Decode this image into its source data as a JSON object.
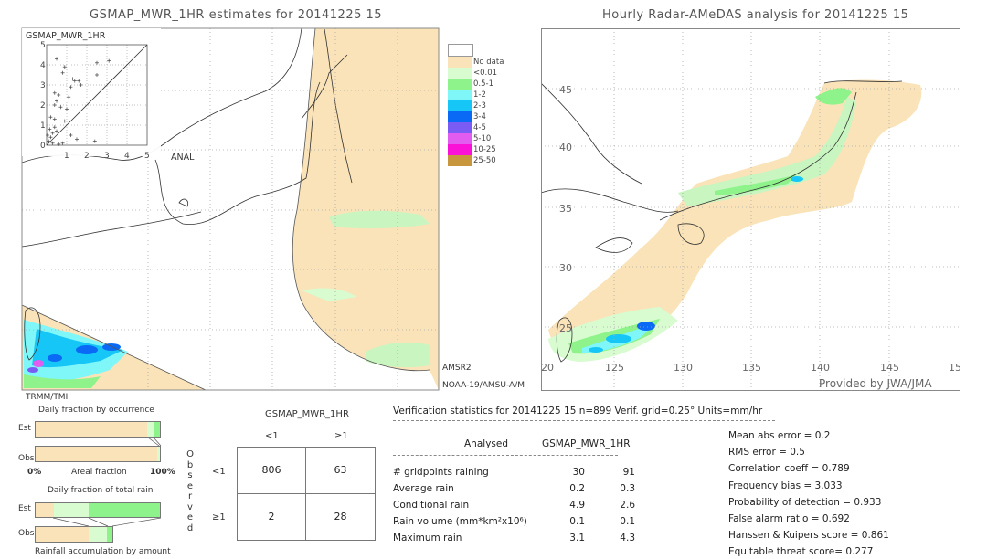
{
  "left_panel": {
    "title": "GSMAP_MWR_1HR estimates for 20141225 15",
    "inset_title": "GSMAP_MWR_1HR",
    "inset_xlabel": "ANAL",
    "sensor_labels": [
      "AMSR2",
      "NOAA-19/AMSU-A/M",
      "TRMM/TMI"
    ]
  },
  "legend": {
    "items": [
      {
        "label": "No data",
        "color": "#fae3b8"
      },
      {
        "label": "<0.01",
        "color": "#d8fbd0"
      },
      {
        "label": "0.5-1",
        "color": "#8ef38a"
      },
      {
        "label": "1-2",
        "color": "#7ff6f8"
      },
      {
        "label": "2-3",
        "color": "#16c6f7"
      },
      {
        "label": "3-4",
        "color": "#0a6af5"
      },
      {
        "label": "4-5",
        "color": "#7a5cf5"
      },
      {
        "label": "5-10",
        "color": "#e35cf0"
      },
      {
        "label": "10-25",
        "color": "#fa10d6"
      },
      {
        "label": "25-50",
        "color": "#c8963c"
      }
    ]
  },
  "right_panel": {
    "title": "Hourly Radar-AMeDAS analysis for 20141225 15",
    "credit": "Provided by JWA/JMA",
    "lat_labels": [
      "45",
      "40",
      "35",
      "30",
      "25"
    ],
    "lon_labels": [
      "20",
      "125",
      "130",
      "135",
      "140",
      "145",
      "15"
    ]
  },
  "occurrence": {
    "title": "Daily fraction by occurrence",
    "est_label": "Est",
    "obs_label": "Obs",
    "axis_left": "0%",
    "axis_mid": "Areal fraction",
    "axis_right": "100%"
  },
  "total_rain": {
    "title": "Daily fraction of total rain",
    "est_label": "Est",
    "obs_label": "Obs",
    "footer": "Rainfall accumulation by amount"
  },
  "contingency": {
    "title": "GSMAP_MWR_1HR",
    "col_labels": [
      "<1",
      "≥1"
    ],
    "row_labels": [
      "<1",
      "≥1"
    ],
    "side_label": [
      "O",
      "b",
      "s",
      "e",
      "r",
      "v",
      "e",
      "d"
    ],
    "cells": [
      [
        "806",
        "63"
      ],
      [
        "2",
        "28"
      ]
    ]
  },
  "stats": {
    "header": "Verification statistics for 20141225 15   n=899   Verif. grid=0.25°   Units=mm/hr",
    "col_analysed": "Analysed",
    "col_gsmap": "GSMAP_MWR_1HR",
    "rows": [
      {
        "label": "# gridpoints raining",
        "a": "30",
        "g": "91"
      },
      {
        "label": "Average rain",
        "a": "0.2",
        "g": "0.3"
      },
      {
        "label": "Conditional rain",
        "a": "4.9",
        "g": "2.6"
      },
      {
        "label": "Rain volume (mm*km²x10⁶)",
        "a": "0.1",
        "g": "0.1"
      },
      {
        "label": "Maximum rain",
        "a": "3.1",
        "g": "4.3"
      }
    ],
    "scores": [
      "Mean abs error = 0.2",
      "RMS error = 0.5",
      "Correlation coeff = 0.789",
      "Frequency bias = 3.033",
      "Probability of detection = 0.933",
      "False alarm ratio = 0.692",
      "Hanssen & Kuipers score = 0.861",
      "Equitable threat score= 0.277"
    ]
  },
  "chart_data": [
    {
      "type": "scatter",
      "title": "GSMAP_MWR_1HR",
      "xlabel": "ANAL",
      "ylabel": "GSMAP_MWR_1HR",
      "xlim": [
        0,
        5
      ],
      "ylim": [
        0,
        5
      ],
      "ticks": [
        "0",
        "1",
        "2",
        "3",
        "4",
        "5"
      ],
      "grid": true,
      "points": [
        [
          0.5,
          4.3
        ],
        [
          2.5,
          4.1
        ],
        [
          3.1,
          4.2
        ],
        [
          2.5,
          3.5
        ],
        [
          0.9,
          3.9
        ],
        [
          0.8,
          3.6
        ],
        [
          1.3,
          3.3
        ],
        [
          1.4,
          3.2
        ],
        [
          1.6,
          3.2
        ],
        [
          1.7,
          3.0
        ],
        [
          1.2,
          2.9
        ],
        [
          0.4,
          2.6
        ],
        [
          0.6,
          2.5
        ],
        [
          1.1,
          2.4
        ],
        [
          0.5,
          2.2
        ],
        [
          0.4,
          2.0
        ],
        [
          0.7,
          1.9
        ],
        [
          1.0,
          1.8
        ],
        [
          0.2,
          1.4
        ],
        [
          0.4,
          1.3
        ],
        [
          0.9,
          1.2
        ],
        [
          2.4,
          0.2
        ],
        [
          1.2,
          0.5
        ],
        [
          0.4,
          0.9
        ],
        [
          0.5,
          0.7
        ],
        [
          0.3,
          0.6
        ],
        [
          0.2,
          0.4
        ],
        [
          0.1,
          0.2
        ],
        [
          0.3,
          0.1
        ],
        [
          0.6,
          0.05
        ],
        [
          0.8,
          0.1
        ],
        [
          1.5,
          0.3
        ],
        [
          0.05,
          0.5
        ],
        [
          0.15,
          0.8
        ]
      ],
      "diagonal": true
    },
    {
      "type": "bar",
      "title": "Daily fraction by occurrence",
      "categories": [
        "Est",
        "Obs"
      ],
      "series": [
        {
          "color": "#fae3b8",
          "values": [
            90,
            98
          ]
        },
        {
          "color": "#d8fbd0",
          "values": [
            5,
            2
          ]
        },
        {
          "color": "#8ef38a",
          "values": [
            5,
            0
          ]
        }
      ],
      "xlim": [
        0,
        100
      ]
    },
    {
      "type": "bar",
      "title": "Daily fraction of total rain",
      "categories": [
        "Est",
        "Obs"
      ],
      "series": [
        {
          "color": "#fae3b8",
          "values": [
            15,
            43
          ]
        },
        {
          "color": "#d8fbd0",
          "values": [
            28,
            15
          ]
        },
        {
          "color": "#8ef38a",
          "values": [
            57,
            4
          ]
        }
      ],
      "xlim": [
        0,
        100
      ]
    },
    {
      "type": "table",
      "title": "GSMAP_MWR_1HR",
      "rows": [
        "<1",
        "≥1"
      ],
      "columns": [
        "<1",
        "≥1"
      ],
      "values": [
        [
          806,
          63
        ],
        [
          2,
          28
        ]
      ]
    }
  ]
}
